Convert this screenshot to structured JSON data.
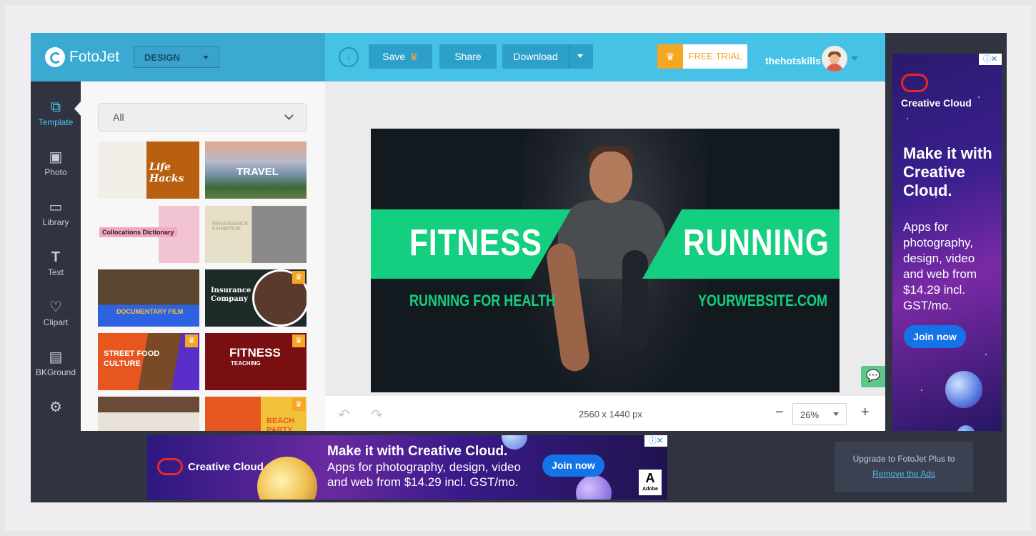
{
  "app": {
    "name": "FotoJet",
    "mode": "DESIGN"
  },
  "toolbar": {
    "save_label": "Save",
    "share_label": "Share",
    "download_label": "Download",
    "free_trial_label": "FREE TRIAL"
  },
  "user": {
    "name": "thehotskills"
  },
  "sidebar": {
    "items": [
      {
        "label": "Template",
        "icon": "template-icon",
        "active": true
      },
      {
        "label": "Photo",
        "icon": "photo-icon"
      },
      {
        "label": "Library",
        "icon": "library-icon"
      },
      {
        "label": "Text",
        "icon": "text-icon"
      },
      {
        "label": "Clipart",
        "icon": "clipart-icon"
      },
      {
        "label": "BKGround",
        "icon": "background-icon"
      },
      {
        "label": "",
        "icon": "settings-icon"
      }
    ]
  },
  "templates": {
    "filter_value": "All",
    "items": [
      {
        "title": "Life Hacks",
        "premium": false
      },
      {
        "title": "TRAVEL",
        "premium": false
      },
      {
        "title": "Collocations Dictionary",
        "premium": false
      },
      {
        "title": "RENAISSANCE EXHIBITION",
        "premium": false
      },
      {
        "title": "DOCUMENTARY FILM",
        "premium": false
      },
      {
        "title": "Insurance Company",
        "premium": true
      },
      {
        "title": "STREET FOOD CULTURE",
        "premium": true
      },
      {
        "title": "FITNESS",
        "subtitle": "TEACHING",
        "premium": true
      },
      {
        "title": "",
        "premium": false
      },
      {
        "title": "BEACH PARTY",
        "premium": true
      }
    ]
  },
  "canvas": {
    "headline_left": "FITNESS",
    "headline_right": "RUNNING",
    "sub_left": "RUNNING FOR HEALTH",
    "sub_right": "YOURWEBSITE.COM",
    "dimensions": "2560 x 1440 px",
    "zoom": "26%",
    "accent_color": "#13cf7f"
  },
  "ads": {
    "right": {
      "brand": "Creative Cloud",
      "headline": "Make it with Creative Cloud.",
      "body": "Apps for photography, design, video and web from $14.29 incl. GST/mo.",
      "cta": "Join now"
    },
    "bottom": {
      "brand": "Creative Cloud",
      "headline": "Make it with Creative Cloud.",
      "body": "Apps for photography, design, video and web from $14.29 incl. GST/mo.",
      "cta": "Join now",
      "adobe_label": "Adobe"
    },
    "close_label": "ⓘ✕"
  },
  "upgrade": {
    "line1": "Upgrade to FotoJet Plus to",
    "link": "Remove the Ads"
  },
  "colors": {
    "topbar": "#45c2e6",
    "brandbar": "#3aaad3",
    "rail": "#2f3440",
    "accent": "#13cf7f",
    "trial": "#f5a623"
  }
}
